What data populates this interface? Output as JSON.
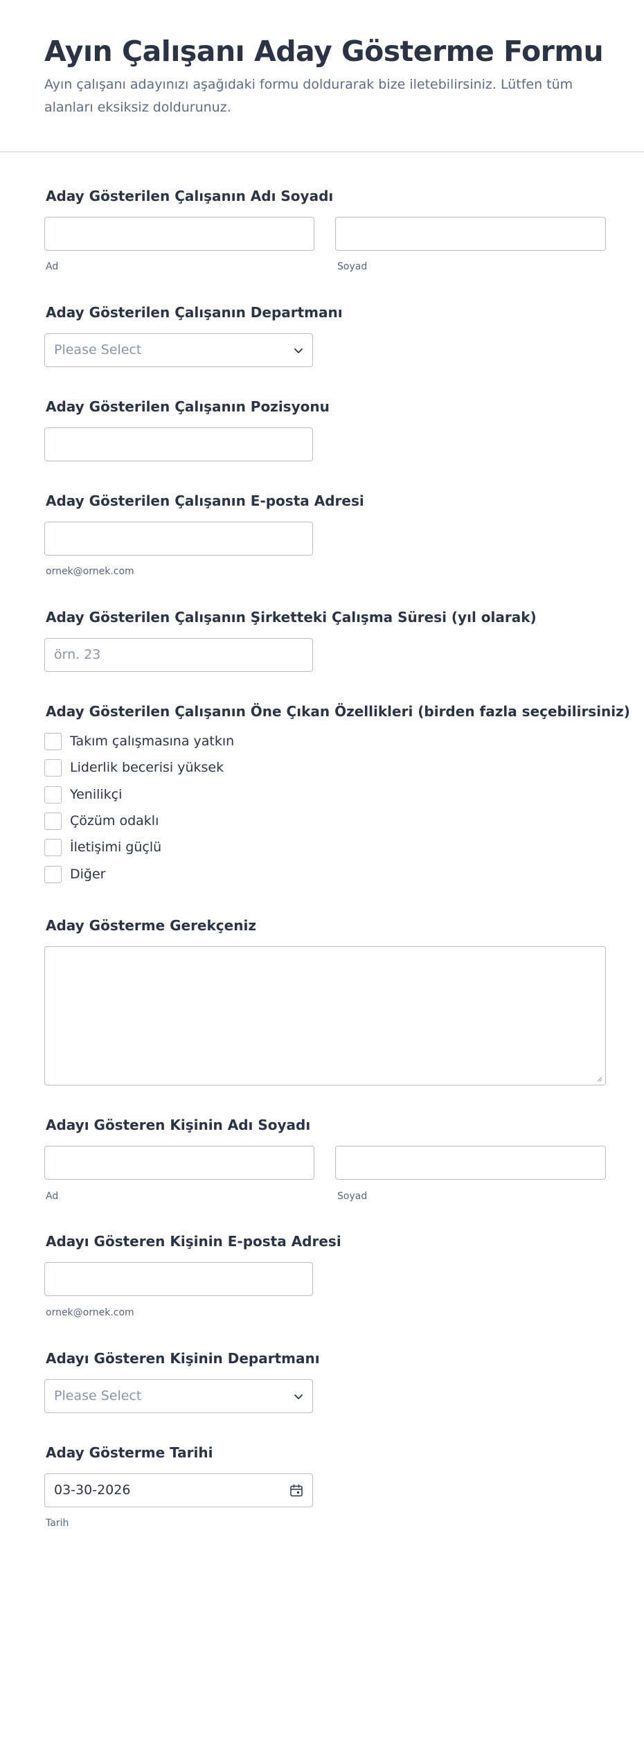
{
  "form": {
    "title": "Ayın Çalışanı Aday Gösterme Formu",
    "subtitle": "Ayın çalışanı adayınızı aşağıdaki formu doldurarak bize iletebilirsiniz. Lütfen tüm alanları eksiksiz doldurunuz."
  },
  "fields": {
    "nominee_name": {
      "label": "Aday Gösterilen Çalışanın Adı Soyadı",
      "first_sublabel": "Ad",
      "last_sublabel": "Soyad"
    },
    "nominee_department": {
      "label": "Aday Gösterilen Çalışanın Departmanı",
      "placeholder": "Please Select"
    },
    "nominee_position": {
      "label": "Aday Gösterilen Çalışanın Pozisyonu"
    },
    "nominee_email": {
      "label": "Aday Gösterilen Çalışanın E-posta Adresi",
      "sublabel": "ornek@ornek.com"
    },
    "nominee_tenure": {
      "label": "Aday Gösterilen Çalışanın Şirketteki Çalışma Süresi (yıl olarak)",
      "placeholder": "örn. 23"
    },
    "nominee_traits": {
      "label": "Aday Gösterilen Çalışanın Öne Çıkan Özellikleri (birden fazla seçebilirsiniz)",
      "options": [
        "Takım çalışmasına yatkın",
        "Liderlik becerisi yüksek",
        "Yenilikçi",
        "Çözüm odaklı",
        "İletişimi güçlü",
        "Diğer"
      ]
    },
    "reason": {
      "label": "Aday Gösterme Gerekçeniz"
    },
    "nominator_name": {
      "label": "Adayı Gösteren Kişinin Adı Soyadı",
      "first_sublabel": "Ad",
      "last_sublabel": "Soyad"
    },
    "nominator_email": {
      "label": "Adayı Gösteren Kişinin E-posta Adresi",
      "sublabel": "ornek@ornek.com"
    },
    "nominator_department": {
      "label": "Adayı Gösteren Kişinin Departmanı",
      "placeholder": "Please Select"
    },
    "nomination_date": {
      "label": "Aday Gösterme Tarihi",
      "value": "03-30-2026",
      "sublabel": "Tarih"
    }
  },
  "colors": {
    "text": "#2c3345",
    "muted": "#5d6c87",
    "border": "#b8bdc9",
    "placeholder": "#8b95a7"
  }
}
